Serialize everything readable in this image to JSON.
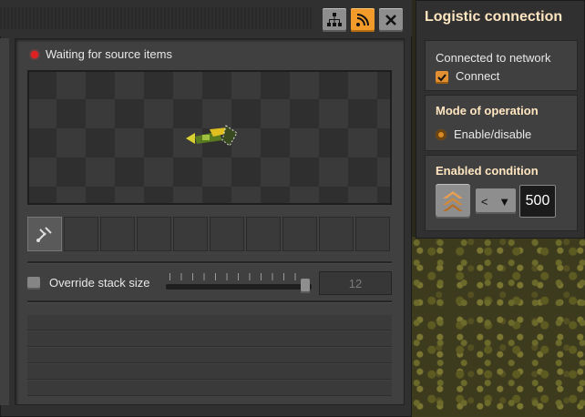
{
  "entity_window": {
    "status_text": "Waiting for source items",
    "status_color": "#e02020",
    "toolbar": {
      "network_icon": "network-tree-icon",
      "logistic_icon": "logistic-connection-icon",
      "close_icon": "close-icon"
    },
    "override": {
      "label": "Override stack size",
      "checked": false,
      "value": "12"
    },
    "slot_count": 10
  },
  "logistic_panel": {
    "title": "Logistic connection",
    "connected_label": "Connected to network",
    "connect_label": "Connect",
    "connect_checked": true,
    "mode_title": "Mode of operation",
    "mode_option": "Enable/disable",
    "condition_title": "Enabled condition",
    "comparator": "<",
    "constant": "500",
    "signal_icon": "stack-inserter-signal-icon"
  },
  "colors": {
    "accent_orange": "#f29a2a",
    "panel_bg": "#313031",
    "heading": "#ffe6c0"
  }
}
